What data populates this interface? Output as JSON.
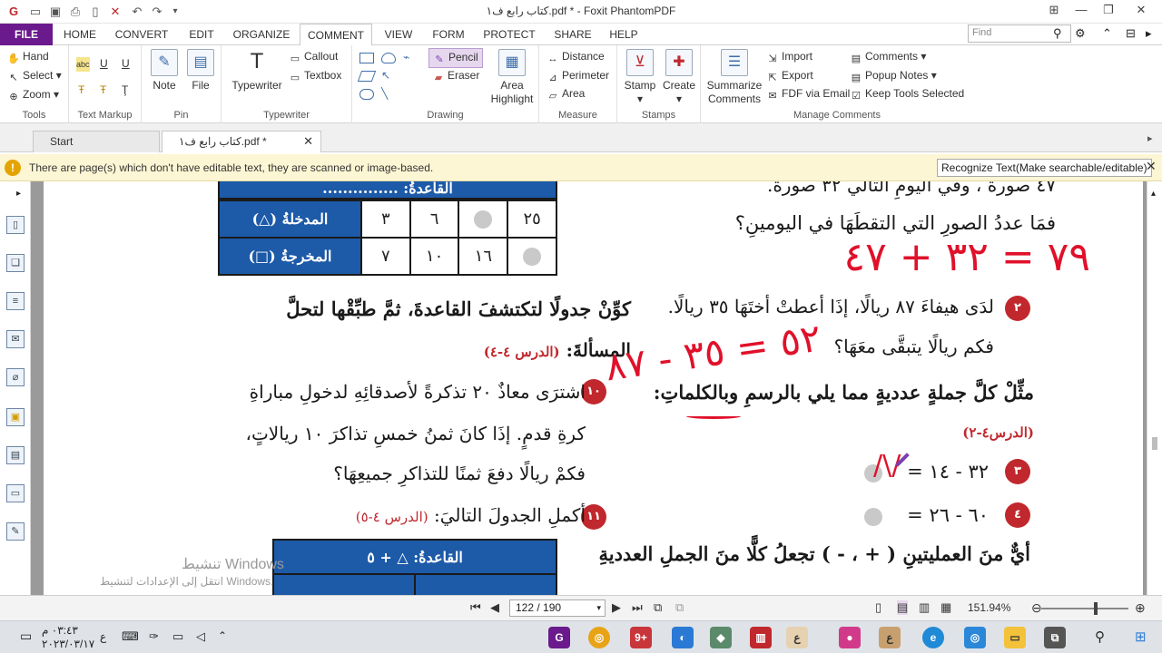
{
  "titlebar": {
    "title": "كتاب رابع ف١.pdf * - Foxit PhantomPDF",
    "quick_access": [
      "folder-icon",
      "save-icon",
      "print-icon",
      "new-doc-icon",
      "undo-icon",
      "redo-icon",
      "customize-icon"
    ]
  },
  "menu": {
    "tabs": [
      "FILE",
      "HOME",
      "CONVERT",
      "EDIT",
      "ORGANIZE",
      "COMMENT",
      "VIEW",
      "FORM",
      "PROTECT",
      "SHARE",
      "HELP"
    ],
    "active_tab": "COMMENT",
    "search_placeholder": "Find"
  },
  "ribbon": {
    "tools": {
      "label": "Tools",
      "hand": "Hand",
      "select": "Select",
      "zoom": "Zoom"
    },
    "text_markup": {
      "label": "Text Markup"
    },
    "pin": {
      "label": "Pin",
      "note": "Note",
      "file": "File"
    },
    "typewriter": {
      "label": "Typewriter",
      "typewriter": "Typewriter",
      "callout": "Callout",
      "textbox": "Textbox"
    },
    "drawing": {
      "label": "Drawing",
      "pencil": "Pencil",
      "eraser": "Eraser",
      "area_highlight_1": "Area",
      "area_highlight_2": "Highlight"
    },
    "measure": {
      "label": "Measure",
      "distance": "Distance",
      "perimeter": "Perimeter",
      "area": "Area"
    },
    "stamps": {
      "label": "Stamps",
      "stamp": "Stamp",
      "create": "Create"
    },
    "manage": {
      "label": "Manage Comments",
      "summarize_1": "Summarize",
      "summarize_2": "Comments",
      "import": "Import",
      "export": "Export",
      "fdf": "FDF via Email",
      "comments": "Comments",
      "popup_notes": "Popup Notes",
      "keep_tools": "Keep Tools Selected"
    }
  },
  "doc_tabs": {
    "start": "Start",
    "file": "كتاب رابع ف١.pdf *"
  },
  "notice": {
    "message": "There are page(s) which don't have editable text, they are scanned or image-based.",
    "button": "Recognize Text(Make searchable/editable)"
  },
  "page": {
    "left": {
      "rule_top": "القاعدةُ: ...............",
      "row_in_label": "المدخلةُ",
      "row_in_values": [
        "٣",
        "٦",
        "",
        "٢٥"
      ],
      "row_out_label": "المخرجةُ",
      "row_out_values": [
        "٧",
        "١٠",
        "١٦",
        ""
      ],
      "instruction": "كوِّنْ جدولًا لتكتشفَ القاعدةَ، ثمَّ طبِّقْها لتحلَّ",
      "problem_title": "المسألةَ:",
      "problem_ref": "(الدرس ٤-٤)",
      "q10_num": "١٠",
      "q10_line1": "اشترَى معاذٌ ٢٠ تذكرةً لأصدقائِهِ لدخولِ مباراةِ",
      "q10_line2": "كرةِ قدمٍ. إذَا كانَ ثمنُ خمسِ تذاكرَ ١٠ ريالاتٍ،",
      "q10_line3": "فكمْ ريالًا دفعَ ثمنًا للتذاكرِ جميعِهَا؟",
      "q11_num": "١١",
      "q11_text": "أكملِ الجدولَ التاليَ:",
      "q11_ref": "(الدرس ٤-٥)",
      "table2_rule": "القاعدةُ:",
      "table2_rule_val": "+ ٥"
    },
    "right": {
      "top_line": "٤٧ صورةً ، وفي اليومِ التالي ٣٢ صورةً.",
      "line2": "فمَا عددُ الصورِ التي التقطَهَا في اليومينِ؟",
      "hand_answer1": "٧٩ = ٣٢ + ٤٧",
      "q2_num": "٢",
      "q2_line1": "لدَى هيفاءَ ٨٧ ريالًا، إذَا أعطتْ أختَهَا ٣٥ ريالًا.",
      "q2_line2": "فكم ريالًا يتبقَّى معَهَا؟",
      "hand_answer2": "٥٢ = ٣٥ - ٨٧",
      "section": "مثِّلْ كلَّ جملةٍ عدديةٍ مما يلي بالرسمِ وبالكلماتِ:",
      "section_ref": "(الدرس٤-٢)",
      "q3_num": "٣",
      "q3_expr": "٣٢ - ١٤ =",
      "q4_num": "٤",
      "q4_expr": "٦٠ - ٢٦ =",
      "bottom": "أيٌّ منَ العمليتينِ ( + ، - ) تجعلُ كلًّا منَ الجملِ العدديةِ"
    },
    "watermark": {
      "line1": "تنشيط Windows",
      "line2": "انتقل إلى الإعدادات لتنشيط Windows."
    }
  },
  "status": {
    "page": "122 / 190",
    "zoom": "151.94%"
  },
  "taskbar": {
    "time": "٠٣:٤٣ م",
    "date": "٢٠٢٣/٠٣/١٧",
    "lang": "ع"
  },
  "colors": {
    "brand": "#6a1a8c",
    "table_blue": "#1d5aa8",
    "accent_red": "#c0282d",
    "ink_red": "#e0102a",
    "ink_purple": "#7a3fb0"
  }
}
